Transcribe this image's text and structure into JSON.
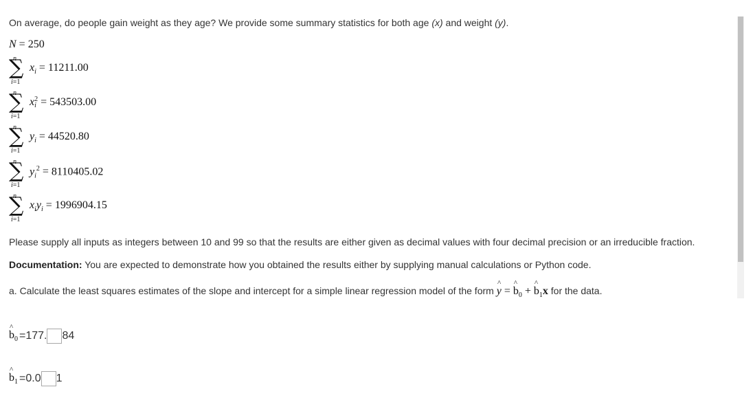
{
  "intro": {
    "text_before_x": "On average, do people gain weight as they age? We provide some summary statistics for both age ",
    "x_var": "(x)",
    "text_between": " and weight ",
    "y_var": "(y)",
    "text_after": "."
  },
  "stats": {
    "N_symbol": "N",
    "N_eq": "=",
    "N_value": "250",
    "sums": [
      {
        "term": "x",
        "sub": "i",
        "sup": "",
        "value": "11211.00"
      },
      {
        "term": "x",
        "sub": "i",
        "sup": "2",
        "value": "543503.00"
      },
      {
        "term": "y",
        "sub": "i",
        "sup": "",
        "value": "44520.80"
      },
      {
        "term": "y",
        "sub": "i",
        "sup": "2",
        "value": "8110405.02"
      },
      {
        "term": "x",
        "sub": "i",
        "term2": "y",
        "sub2": "i",
        "value": "1996904.15"
      }
    ],
    "upper": "n",
    "lower_var": "i",
    "lower_eq": "=1"
  },
  "instructions": "Please supply all inputs as integers between 10 and 99 so that the results are either given as decimal values with four decimal precision or an irreducible fraction.",
  "documentation": {
    "label": "Documentation:",
    "text": " You are expected to demonstrate how you obtained the results either by supplying manual calculations or Python code."
  },
  "question_a": {
    "before": "a. Calculate the least squares estimates of the slope and intercept for a simple linear regression model of the form ",
    "after": " for the data."
  },
  "answers": {
    "b0": {
      "label_sub": "0",
      "eq": "=",
      "prefix": "177.",
      "input_value": "",
      "suffix": "84"
    },
    "b1": {
      "label_sub": "1",
      "eq": "=",
      "prefix": "0.0",
      "input_value": "",
      "suffix": "1"
    }
  }
}
